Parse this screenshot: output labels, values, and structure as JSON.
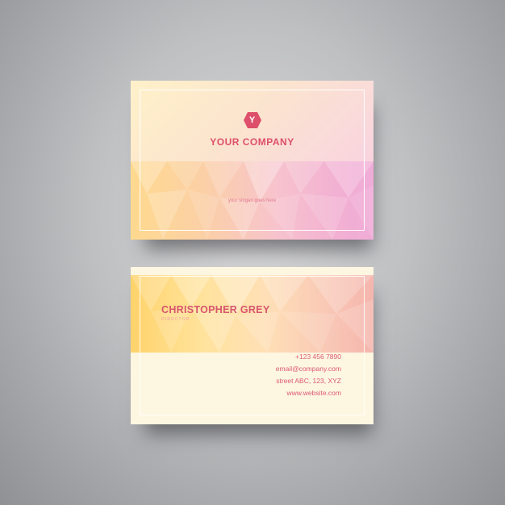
{
  "front_card": {
    "logo_letter": "Y",
    "company": "YOUR COMPANY",
    "slogan": "your slogan goes here"
  },
  "back_card": {
    "name": "CHRISTOPHER GREY",
    "title": "DIRECTOR",
    "contacts": [
      "+123 456 7890",
      "email@company.com",
      "street ABC, 123, XYZ",
      "www.website.com"
    ]
  },
  "colors": {
    "accent": "#dd4f6a",
    "background": "#bfc0c2",
    "card_cream": "#fdf6e1"
  }
}
